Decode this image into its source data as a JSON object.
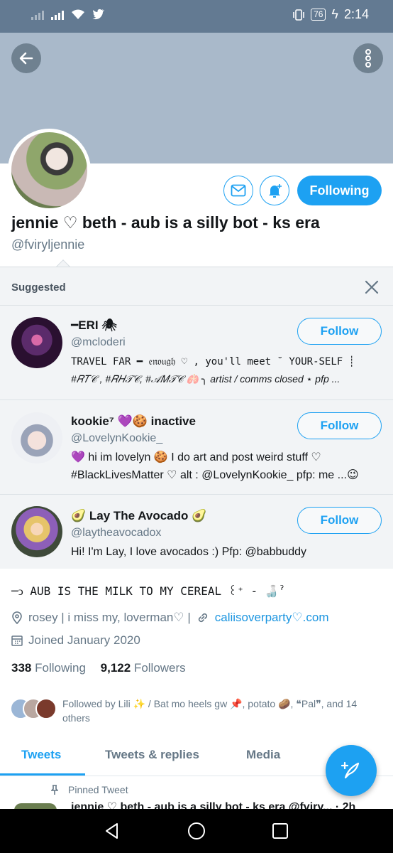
{
  "status_bar": {
    "battery": "76",
    "time": "2:14"
  },
  "header": {
    "back_icon": "arrow-left-icon",
    "more_icon": "vertical-dots-icon"
  },
  "profile": {
    "display_name": "jennie ♡ beth - aub is a silly bot - ks era",
    "handle": "@fviryljennie",
    "following_label": "Following",
    "bio": "─ↄ AUB IS THE MILK TO MY CEREAL ꒰⁺ - 🍶ˀ",
    "location": "rosey | i miss my, loverman♡ |",
    "website": "caliisoverparty♡.com",
    "joined": "Joined January 2020",
    "following_count": "338",
    "following_text": "Following",
    "followers_count": "9,122",
    "followers_text": "Followers",
    "followed_by": "Followed by Lili ✨ / Bat mo heels gw 📌, potato 🥔, ❝Pal❞, and 14 others"
  },
  "suggested": {
    "title": "Suggested",
    "follow_label": "Follow",
    "items": [
      {
        "name": "━ERI 🕷",
        "handle": "@mcloderi",
        "bio_line1": "TRAVEL FAR ━ 𝔢𝔫𝔬𝔲𝔤𝔥 ♡ , you'll meet ˘ YOUR-SELF ┊",
        "bio_line2": "#𝑅𝑇𝒞 , #𝑅𝐻𝒯𝒞, #𝒜𝑀𝒯𝒞 🫁 ╮ artist / comms closed ⋆ pfp ..."
      },
      {
        "name": "kookie⁷ 💜🍪 inactive",
        "handle": "@LovelynKookie_",
        "bio_line1": "💜 hi im lovelyn 🍪 I do art and post weird stuff ♡",
        "bio_line2": "#BlackLivesMatter ♡ alt : @LovelynKookie_ pfp: me ...😉"
      },
      {
        "name": "🥑 Lay The Avocado 🥑",
        "handle": "@laytheavocadox",
        "bio_line1": "Hi! I'm Lay, I love avocados :)  Pfp: @babbuddy",
        "bio_line2": ""
      }
    ]
  },
  "tabs": [
    "Tweets",
    "Tweets & replies",
    "Media"
  ],
  "pinned": {
    "label": "Pinned Tweet",
    "peek": "jennie ♡ beth - aub is a silly bot - ks era @fviry... · 2h"
  },
  "colors": {
    "accent": "#1da1f2",
    "banner": "#a9b9ca",
    "status_bar": "#637a92"
  }
}
